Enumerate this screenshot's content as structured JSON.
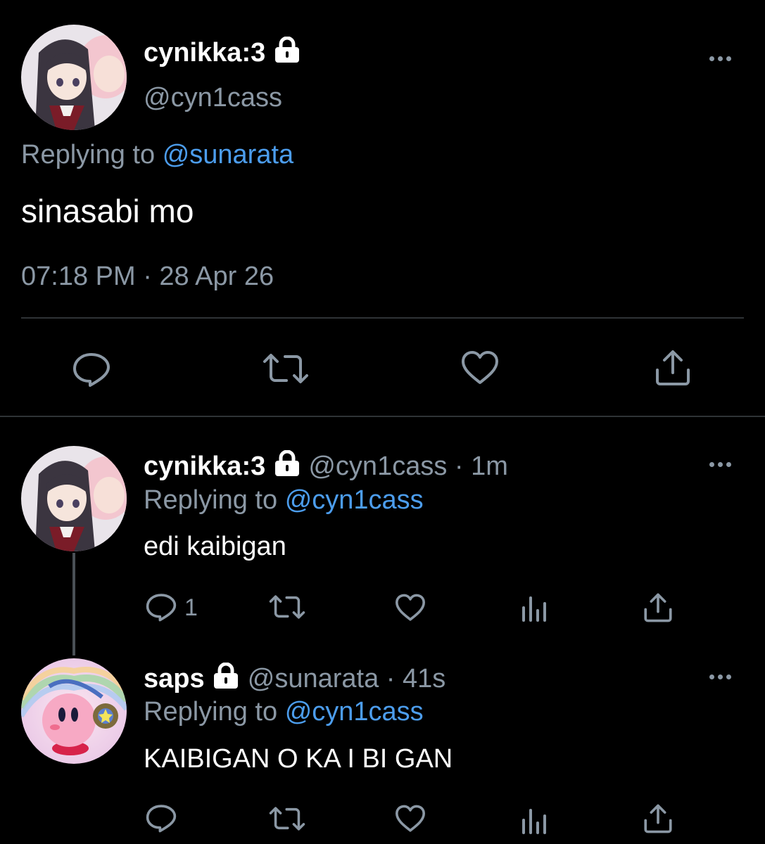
{
  "main_tweet": {
    "display_name": "cynikka:3",
    "handle": "@cyn1cass",
    "replying_prefix": "Replying to",
    "replying_to": "@sunarata",
    "text": "sinasabi mo",
    "timestamp": "07:18 PM · 28 Apr 26"
  },
  "replies": [
    {
      "display_name": "cynikka:3",
      "handle": "@cyn1cass",
      "age": "· 1m",
      "replying_prefix": "Replying to",
      "replying_to": "@cyn1cass",
      "text": "edi kaibigan",
      "reply_count": "1"
    },
    {
      "display_name": "saps",
      "handle": "@sunarata",
      "age": "· 41s",
      "replying_prefix": "Replying to",
      "replying_to": "@cyn1cass",
      "text": "KAIBIGAN O KA I BI GAN",
      "reply_count": ""
    }
  ],
  "colors": {
    "background": "#000000",
    "muted_text": "#8b98a5",
    "link": "#4c9ded",
    "divider": "#2f3336"
  },
  "icons": [
    "lock-icon",
    "more-icon",
    "reply-icon",
    "retweet-icon",
    "like-icon",
    "share-icon",
    "analytics-icon"
  ]
}
